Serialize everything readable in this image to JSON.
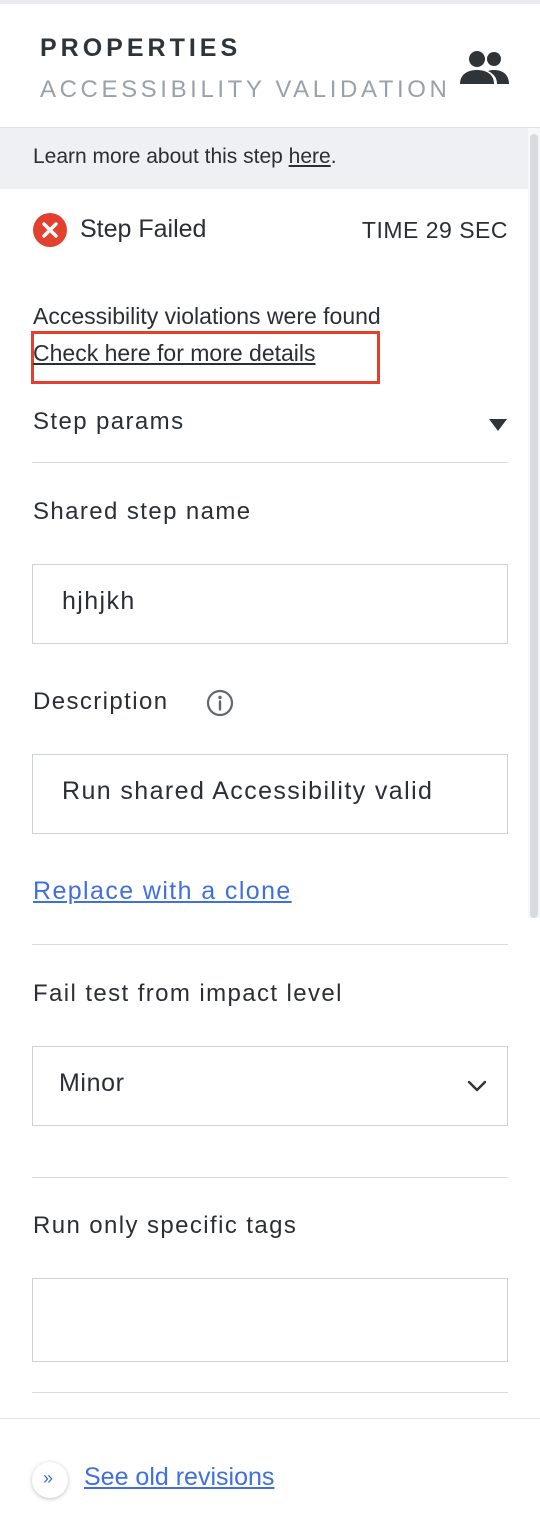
{
  "header": {
    "title": "PROPERTIES",
    "subtitle": "ACCESSIBILITY VALIDATION",
    "icon": "people-icon"
  },
  "learn_more": {
    "prefix": "Learn more about this step ",
    "link": "here",
    "suffix": "."
  },
  "status": {
    "icon": "error-circle-icon",
    "label": "Step Failed",
    "time": "TIME 29 SEC"
  },
  "violations": {
    "message": "Accessibility violations were found",
    "details_link": "Check here for more details"
  },
  "step_params": {
    "label": "Step params",
    "icon": "caret-down-icon"
  },
  "shared_step_name": {
    "label": "Shared step name",
    "value": "hjhjkh"
  },
  "description": {
    "label": "Description",
    "icon": "info-icon",
    "value": "Run shared Accessibility valid"
  },
  "clone_link": "Replace with a clone",
  "impact_level": {
    "label": "Fail test from impact level",
    "selected": "Minor",
    "icon": "chevron-down-icon"
  },
  "tags": {
    "label": "Run only specific tags",
    "value": ""
  },
  "footer": {
    "revisions_link": "See old revisions",
    "icon": "double-chevron-right-icon"
  },
  "colors": {
    "error": "#e2412f",
    "link": "#3f6fe0",
    "highlight_box": "#e2412f"
  }
}
